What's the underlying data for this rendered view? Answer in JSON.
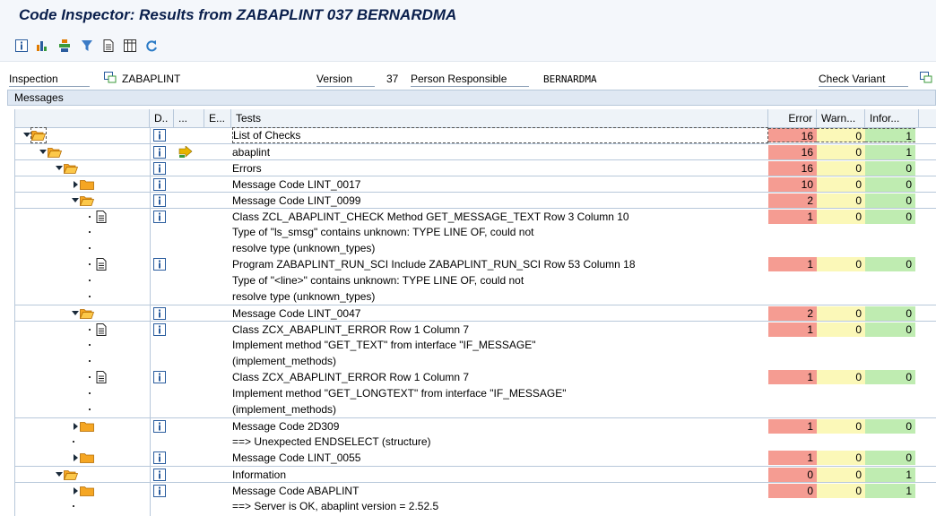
{
  "window": {
    "title": "Code Inspector: Results from ZABAPLINT 037 BERNARDMA"
  },
  "toolbar": {
    "icons": [
      "info-icon",
      "chart-icon",
      "hierarchy-icon",
      "filter-icon",
      "document-icon",
      "grid-icon",
      "refresh-icon"
    ]
  },
  "header": {
    "inspection_label": "Inspection",
    "inspection_value": "ZABAPLINT",
    "version_label": "Version",
    "version_value": "37",
    "person_label": "Person Responsible",
    "person_value": "BERNARDMA",
    "check_variant_label": "Check Variant"
  },
  "messages_section": {
    "label": "Messages"
  },
  "grid": {
    "columns": {
      "d": "D..",
      "dots": "...",
      "e": "E...",
      "tests": "Tests",
      "error": "Error",
      "warn": "Warn...",
      "info": "Infor..."
    },
    "rows": [
      {
        "text": "List of Checks",
        "err": "16",
        "warn": "0",
        "info": "1"
      },
      {
        "text": "abaplint",
        "err": "16",
        "warn": "0",
        "info": "1"
      },
      {
        "text": "Errors",
        "err": "16",
        "warn": "0",
        "info": "0"
      },
      {
        "text": "Message Code LINT_0017",
        "err": "10",
        "warn": "0",
        "info": "0"
      },
      {
        "text": "Message Code LINT_0099",
        "err": "2",
        "warn": "0",
        "info": "0"
      },
      {
        "text": "Class ZCL_ABAPLINT_CHECK Method GET_MESSAGE_TEXT Row 3 Column 10",
        "err": "1",
        "warn": "0",
        "info": "0"
      },
      {
        "text": " Type of \"ls_smsg\" contains unknown: TYPE LINE OF, could not"
      },
      {
        "text": "resolve type (unknown_types)"
      },
      {
        "text": "Program ZABAPLINT_RUN_SCI Include ZABAPLINT_RUN_SCI Row 53 Column 18",
        "err": "1",
        "warn": "0",
        "info": "0"
      },
      {
        "text": " Type of \"<line>\" contains unknown: TYPE LINE OF, could not"
      },
      {
        "text": "resolve type (unknown_types)"
      },
      {
        "text": "Message Code LINT_0047",
        "err": "2",
        "warn": "0",
        "info": "0"
      },
      {
        "text": "Class ZCX_ABAPLINT_ERROR Row 1 Column 7",
        "err": "1",
        "warn": "0",
        "info": "0"
      },
      {
        "text": " Implement method \"GET_TEXT\" from interface \"IF_MESSAGE\""
      },
      {
        "text": "(implement_methods)"
      },
      {
        "text": "Class ZCX_ABAPLINT_ERROR Row 1 Column 7",
        "err": "1",
        "warn": "0",
        "info": "0"
      },
      {
        "text": " Implement method \"GET_LONGTEXT\" from interface \"IF_MESSAGE\""
      },
      {
        "text": "(implement_methods)"
      },
      {
        "text": "Message Code 2D309",
        "err": "1",
        "warn": "0",
        "info": "0"
      },
      {
        "text": "==> Unexpected ENDSELECT (structure)"
      },
      {
        "text": "Message Code LINT_0055",
        "err": "1",
        "warn": "0",
        "info": "0"
      },
      {
        "text": "Information",
        "err": "0",
        "warn": "0",
        "info": "1"
      },
      {
        "text": "Message Code ABAPLINT",
        "err": "0",
        "warn": "0",
        "info": "1"
      },
      {
        "text": "==> Server is OK, abaplint version = 2.52.5"
      }
    ]
  },
  "colors": {
    "error": "#f59c92",
    "warning": "#fbf8b8",
    "information": "#bfecb1",
    "folder": "#f5a623"
  }
}
